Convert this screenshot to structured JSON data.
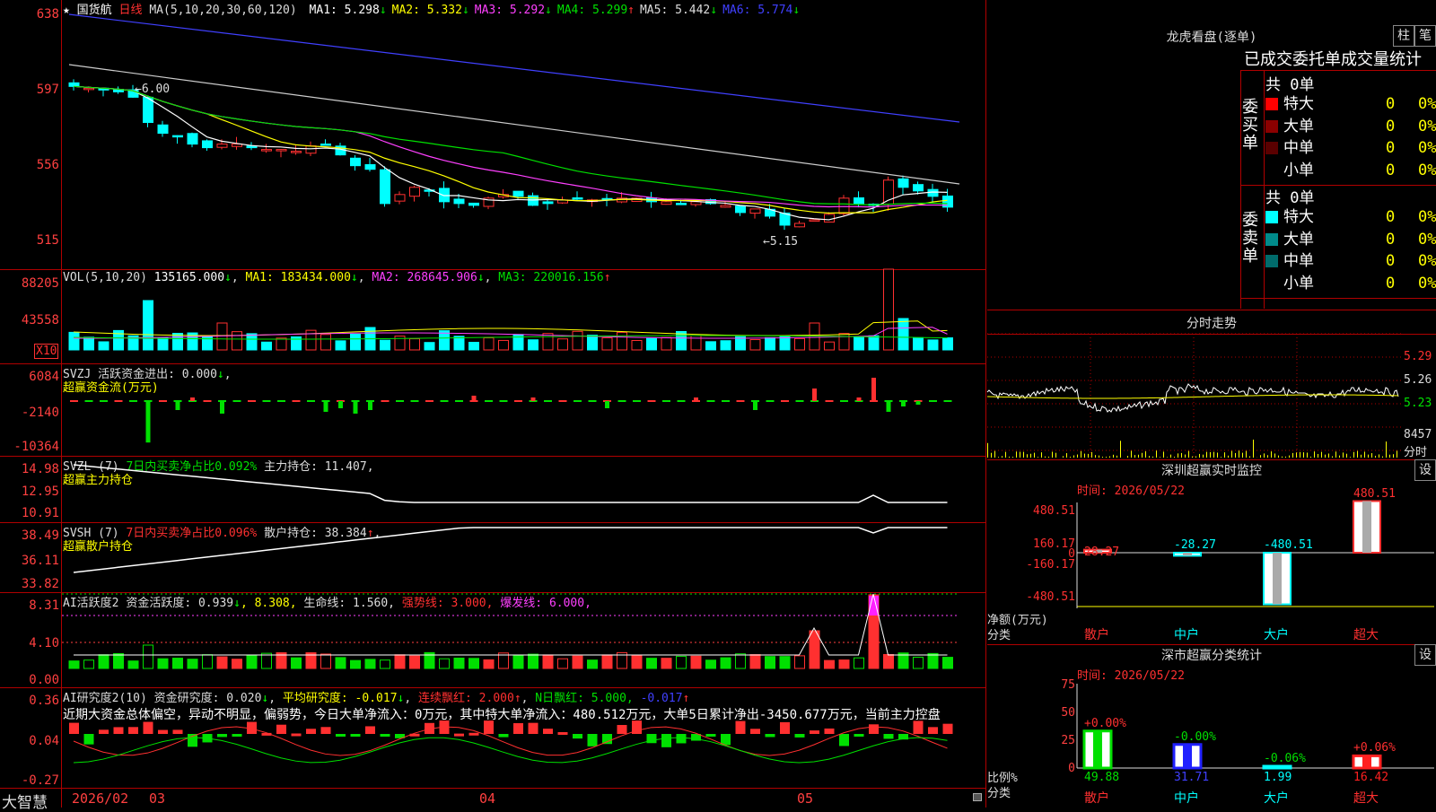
{
  "header": {
    "star": "★",
    "stock": "国货航",
    "period": "日线",
    "ma_params": "MA(5,10,20,30,60,120)",
    "ma": [
      {
        "label": "MA1:",
        "value": "5.298",
        "arrow": "↓",
        "color": "#ffffff"
      },
      {
        "label": "MA2:",
        "value": "5.332",
        "arrow": "↓",
        "color": "#ffff00"
      },
      {
        "label": "MA3:",
        "value": "5.292",
        "arrow": "↓",
        "color": "#ff40ff"
      },
      {
        "label": "MA4:",
        "value": "5.299",
        "arrow": "↑",
        "color": "#00e000"
      },
      {
        "label": "MA5:",
        "value": "5.442",
        "arrow": "↓",
        "color": "#dddddd"
      },
      {
        "label": "MA6:",
        "value": "5.774",
        "arrow": "↓",
        "color": "#4040ff"
      }
    ]
  },
  "price_axis": [
    "638",
    "597",
    "556",
    "515"
  ],
  "price_annotations": {
    "high": "6.00",
    "low": "5.15"
  },
  "vol": {
    "title": "VOL(5,10,20)",
    "value": "135165.000",
    "arrow": "↓",
    "ma1": "MA1: 183434.000",
    "ma1_arrow": "↓",
    "ma2": "MA2: 268645.906",
    "ma2_arrow": "↓",
    "ma3": "MA3: 220016.156",
    "ma3_arrow": "↑",
    "axis": [
      "88205",
      "43558"
    ],
    "unit": "X10"
  },
  "svzj": {
    "title": "SVZJ  活跃资金进出: 0.000",
    "arrow": "↓",
    "sub": "超赢资金流(万元)",
    "axis": [
      "6084",
      "-2140",
      "-10364"
    ]
  },
  "svzl": {
    "title": "SVZL (7)",
    "t2": "7日内买卖净占比0.092%",
    "t3": "主力持仓: 11.407,",
    "sub": "超赢主力持仓",
    "axis": [
      "14.98",
      "12.95",
      "10.91"
    ]
  },
  "svsh": {
    "title": "SVSH (7)",
    "t2": "7日内买卖净占比0.096%",
    "t3": "散户持仓: 38.384",
    "arrow": "↑",
    "sub": "超赢散户持仓",
    "axis": [
      "38.49",
      "36.11",
      "33.82"
    ]
  },
  "ai_active": {
    "title": "AI活跃度2",
    "t2": "资金活跃度: 0.939",
    "a2": "↓",
    "t3": ", 8.308,",
    "t4": "生命线: 1.560,",
    "t5": "强势线: 3.000,",
    "t6": "爆发线: 6.000,",
    "axis": [
      "8.31",
      "4.10",
      "0.00"
    ]
  },
  "ai_research": {
    "title": "AI研究度2(10)",
    "t2": "资金研究度: 0.020",
    "a2": "↓",
    "t3": "平均研究度: -0.017",
    "a3": "↓",
    "t4": "连续飘红: 2.000",
    "a4": "↑",
    "t5": "N日飘红: 5.000,",
    "t6": "-0.017",
    "a6": "↑",
    "axis": [
      "0.36",
      "0.04",
      "-0.27"
    ],
    "text": "近期大资金总体偏空，异动不明显，偏弱势，今日大单净流入：0万元，其中特大单净流入：480.512万元，大单5日累计净出-3450.677万元，当前主力控盘"
  },
  "dates": {
    "brand": "大智慧",
    "d1": "2026/02",
    "d2": "03",
    "d3": "04",
    "d4": "05"
  },
  "dragon": {
    "title": "龙虎看盘(逐单)",
    "btn1": "柱",
    "btn2": "笔",
    "tabs": "已成交委托单成交量统计",
    "buy_label": "委买单",
    "sell_label": "委卖单",
    "buy_total": "共 0单",
    "sell_total": "共 0单",
    "buy_rows": [
      {
        "name": "特大",
        "v": "0",
        "p": "0%",
        "c": "#ff0000"
      },
      {
        "name": "大单",
        "v": "0",
        "p": "0%",
        "c": "#8b0000"
      },
      {
        "name": "中单",
        "v": "0",
        "p": "0%",
        "c": "#5a0000"
      },
      {
        "name": "小单",
        "v": "0",
        "p": "0%",
        "c": "#000000"
      }
    ],
    "sell_rows": [
      {
        "name": "特大",
        "v": "0",
        "p": "0%",
        "c": "#00ffff"
      },
      {
        "name": "大单",
        "v": "0",
        "p": "0%",
        "c": "#008b8b"
      },
      {
        "name": "中单",
        "v": "0",
        "p": "0%",
        "c": "#006b6b"
      },
      {
        "name": "小单",
        "v": "0",
        "p": "0%",
        "c": "#000000"
      }
    ]
  },
  "intraday": {
    "title": "分时走势",
    "axis": [
      "5.29",
      "5.26",
      "5.23"
    ],
    "vol": "8457",
    "vol_label": "分时"
  },
  "monitor": {
    "title": "深圳超赢实时监控",
    "btn": "设",
    "time": "时间: 2026/05/22",
    "axis": [
      "480.51",
      "160.17",
      "0",
      "-160.17",
      "-480.51"
    ],
    "unit": "净额(万元)",
    "cat_label": "分类",
    "bars": [
      {
        "cat": "散户",
        "val": "28.27",
        "v": 28.27
      },
      {
        "cat": "中户",
        "val": "-28.27",
        "v": -28.27
      },
      {
        "cat": "大户",
        "val": "-480.51",
        "v": -480.51
      },
      {
        "cat": "超大",
        "val": "480.51",
        "v": 480.51
      }
    ]
  },
  "classify": {
    "title": "深市超赢分类统计",
    "btn": "设",
    "time": "时间: 2026/05/22",
    "axis": [
      "75",
      "50",
      "25",
      "0"
    ],
    "unit": "比例%",
    "cat_label": "分类",
    "bars": [
      {
        "cat": "散户",
        "top": "+0.00%",
        "bottom": "49.88",
        "v": 49.88,
        "color": "#00e000"
      },
      {
        "cat": "中户",
        "top": "-0.00%",
        "bottom": "31.71",
        "v": 31.71,
        "color": "#2020ff"
      },
      {
        "cat": "大户",
        "top": "-0.06%",
        "bottom": "1.99",
        "v": 1.99,
        "color": "#00ffff"
      },
      {
        "cat": "超大",
        "top": "+0.06%",
        "bottom": "16.42",
        "v": 16.42,
        "color": "#ff2020"
      }
    ]
  }
}
